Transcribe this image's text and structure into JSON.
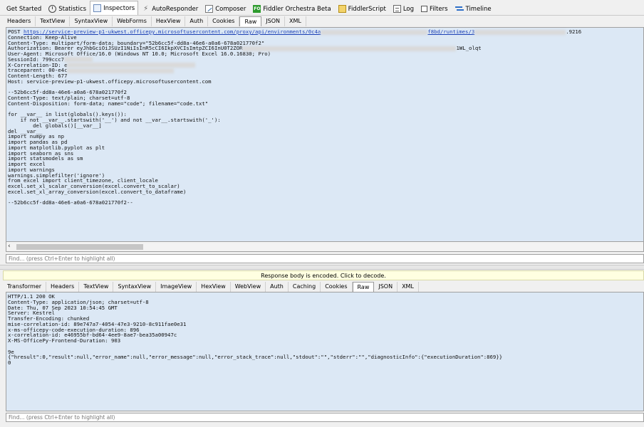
{
  "top_tabs": [
    {
      "label": "Get Started",
      "icon": "none"
    },
    {
      "label": "Statistics",
      "icon": "statistics-icon"
    },
    {
      "label": "Inspectors",
      "icon": "inspectors-icon"
    },
    {
      "label": "AutoResponder",
      "icon": "lightning-icon"
    },
    {
      "label": "Composer",
      "icon": "composer-icon"
    },
    {
      "label": "Fiddler Orchestra Beta",
      "icon": "fo-icon",
      "icon_text": "FO"
    },
    {
      "label": "FiddlerScript",
      "icon": "script-icon"
    },
    {
      "label": "Log",
      "icon": "log-icon"
    },
    {
      "label": "Filters",
      "icon": "checkbox-icon"
    },
    {
      "label": "Timeline",
      "icon": "timeline-icon"
    }
  ],
  "request": {
    "tabs": [
      "Headers",
      "TextView",
      "SyntaxView",
      "WebForms",
      "HexView",
      "Auth",
      "Cookies",
      "Raw",
      "JSON",
      "XML"
    ],
    "active_tab": "Raw",
    "url_prefix": "POST ",
    "url": "https://service-preview-p1-ukwest.officepy.microsoftusercontent.com/proxy/api/environments/0c4a",
    "url_tail": "f8bd/runtimes/3",
    "url_end": ".9216",
    "line_connection": "Connection: Keep-Alive",
    "line_content_type": "Content-Type: multipart/form-data; boundary=\"52b6cc5f-dd8a-46e6-a0a6-678a021770f2\"",
    "line_authorization": "Authorization: Bearer eyJhbGciOiJSUzI1NiIsInR5cCI6IkpXVCIsImtpZCI6InU0T2ZOR",
    "auth_tail": "1WL_olqt",
    "line_user_agent": "User-Agent: Microsoft Office/16.0 (Windows NT 10.0; Microsoft Excel 16.0.16830; Pro)",
    "line_session": "SessionId: 799ccc7",
    "line_correlation": "X-Correlation-ID: e",
    "line_traceparent": "traceparent: 00-e4c",
    "line_content_length": "Content-Length: 677",
    "line_host": "Host: service-preview-p1-ukwest.officepy.microsoftusercontent.com",
    "body": "--52b6cc5f-dd8a-46e6-a0a6-678a021770f2\nContent-Type: text/plain; charset=utf-8\nContent-Disposition: form-data; name=\"code\"; filename=\"code.txt\"\n\nfor __var__ in list(globals().keys()):\n    if not __var__.startswith('__') and not __var__.startswith('_'):\n        del globals()[__var__]\ndel __var__\nimport numpy as np\nimport pandas as pd\nimport matplotlib.pyplot as plt\nimport seaborn as sns\nimport statsmodels as sm\nimport excel\nimport warnings\nwarnings.simplefilter('ignore')\nfrom excel import client_timezone, client_locale\nexcel.set_xl_scalar_conversion(excel.convert_to_scalar)\nexcel.set_xl_array_conversion(excel.convert_to_dataframe)\n\n--52b6cc5f-dd8a-46e6-a0a6-678a021770f2--",
    "find_placeholder": "Find... (press Ctrl+Enter to highlight all)"
  },
  "banner": "Response body is encoded. Click to decode.",
  "response": {
    "tabs": [
      "Transformer",
      "Headers",
      "TextView",
      "SyntaxView",
      "ImageView",
      "HexView",
      "WebView",
      "Auth",
      "Caching",
      "Cookies",
      "Raw",
      "JSON",
      "XML"
    ],
    "active_tab": "Raw",
    "raw": "HTTP/1.1 200 OK\nContent-Type: application/json; charset=utf-8\nDate: Thu, 07 Sep 2023 10:54:45 GMT\nServer: Kestrel\nTransfer-Encoding: chunked\nmise-correlation-id: 89e747a7-4054-47e3-9210-8c911fae0e31\nx-ms-officepy-code-execution-duration: 896\nx-correlation-id: e46955bf-bd64-4ee9-8ae7-bea35a00947c\nX-MS-OfficePy-Frontend-Duration: 903\n\n9e\n{\"hresult\":0,\"result\":null,\"error_name\":null,\"error_message\":null,\"error_stack_trace\":null,\"stdout\":\"\",\"stderr\":\"\",\"diagnosticInfo\":{\"executionDuration\":869}}\n0",
    "find_placeholder": "Find... (press Ctrl+Enter to highlight all)"
  }
}
